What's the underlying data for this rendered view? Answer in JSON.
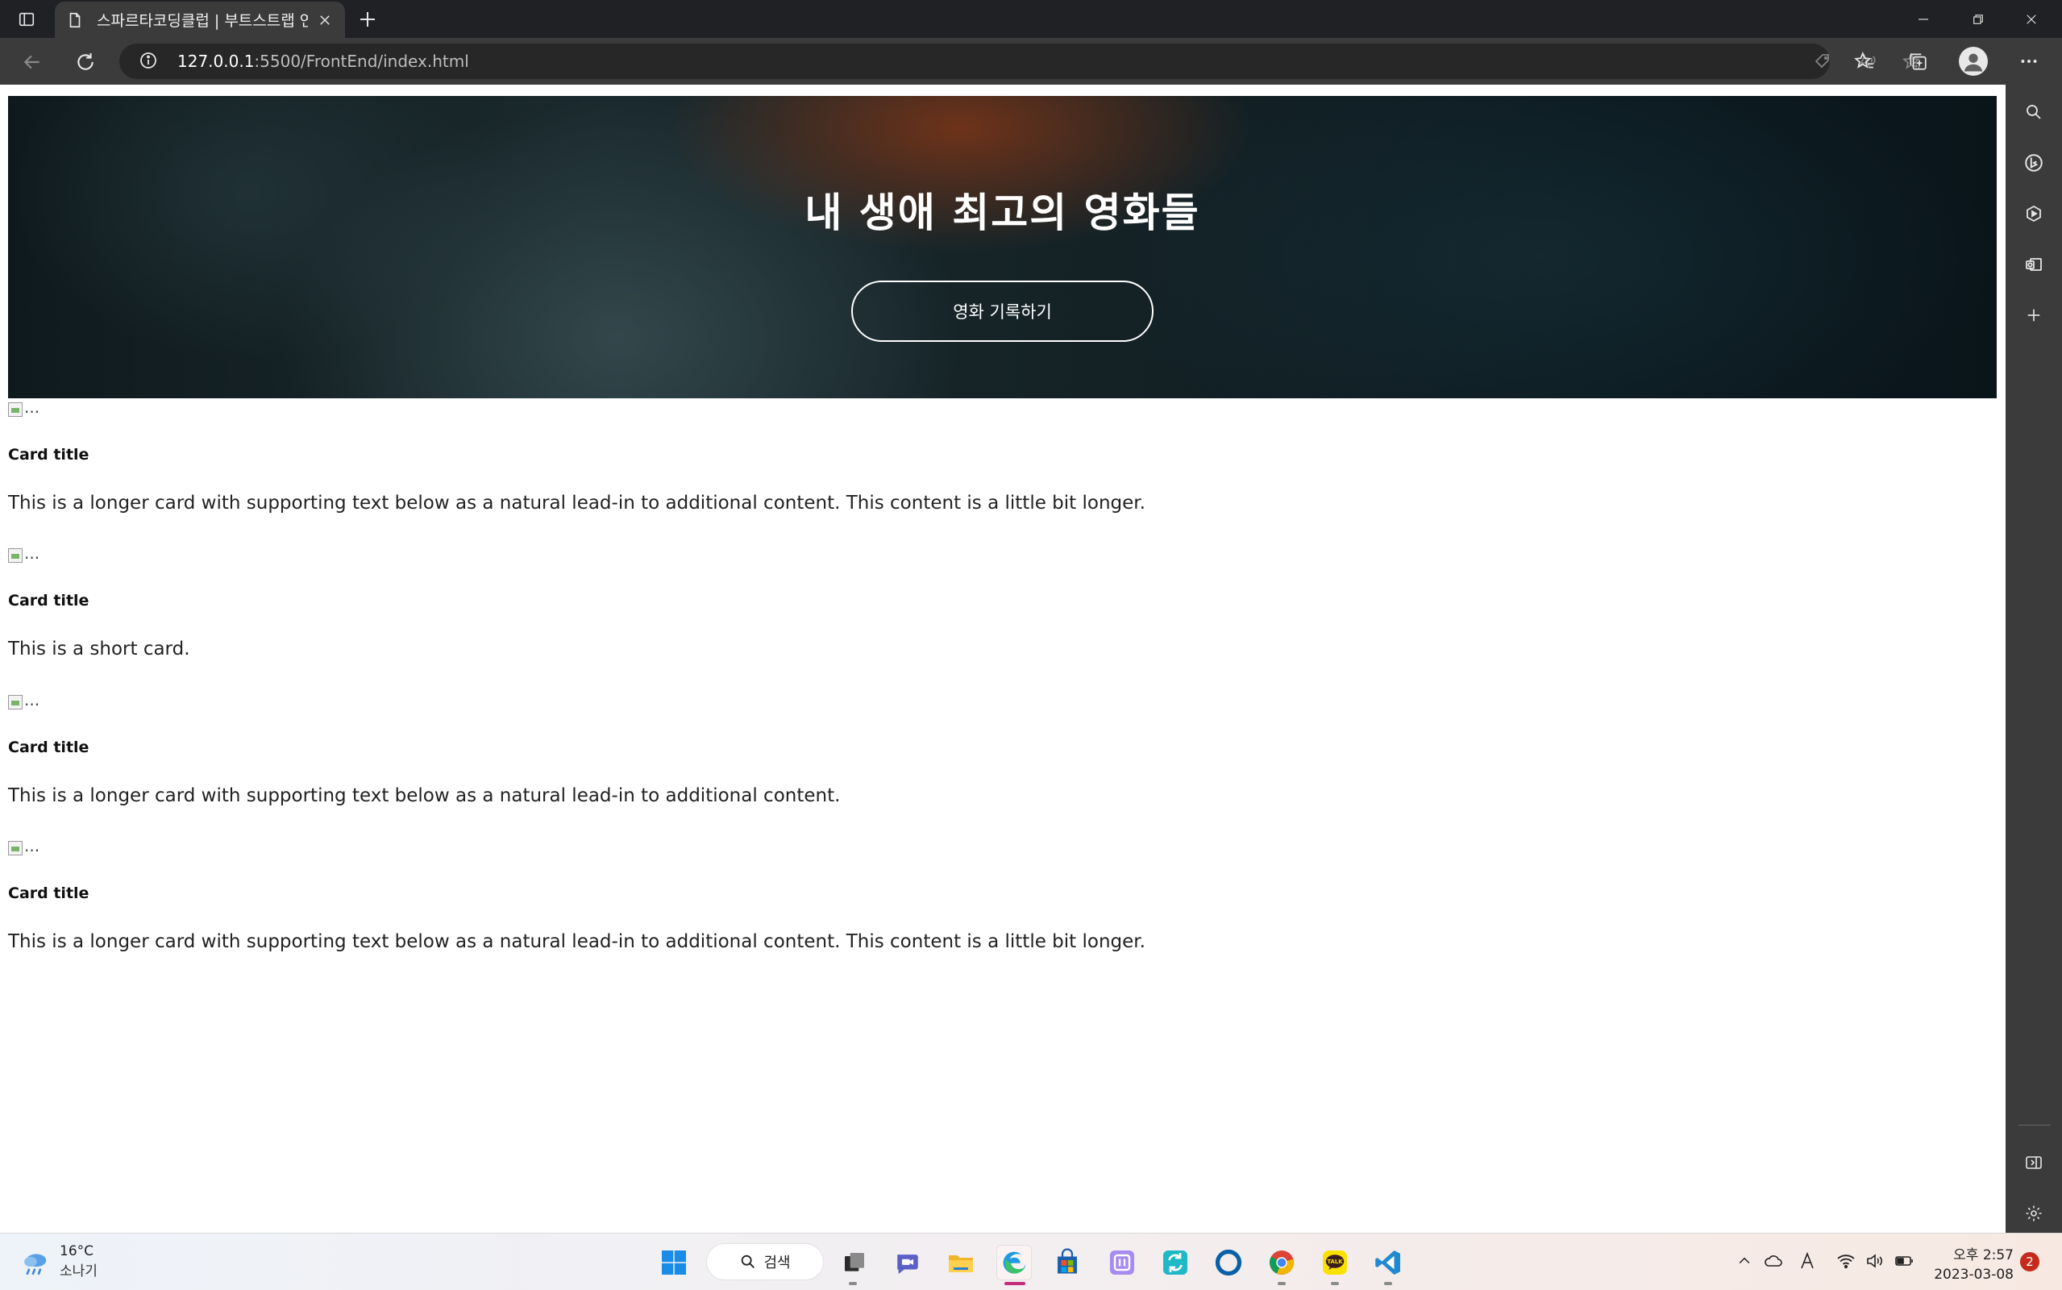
{
  "browser": {
    "tab_title": "스파르타코딩클럽 | 부트스트랩 연습",
    "url_host": "127.0.0.1",
    "url_path": ":5500/FrontEnd/index.html"
  },
  "hero": {
    "title": "내 생애 최고의 영화들",
    "button_label": "영화 기록하기"
  },
  "cards": [
    {
      "img_alt": "...",
      "title": "Card title",
      "text": "This is a longer card with supporting text below as a natural lead-in to additional content. This content is a little bit longer."
    },
    {
      "img_alt": "...",
      "title": "Card title",
      "text": "This is a short card."
    },
    {
      "img_alt": "...",
      "title": "Card title",
      "text": "This is a longer card with supporting text below as a natural lead-in to additional content."
    },
    {
      "img_alt": "...",
      "title": "Card title",
      "text": "This is a longer card with supporting text below as a natural lead-in to additional content. This content is a little bit longer."
    }
  ],
  "taskbar": {
    "weather_temp": "16°C",
    "weather_condition": "소나기",
    "search_label": "검색",
    "time": "오후 2:57",
    "date": "2023-03-08",
    "notification_count": "2"
  },
  "colors": {
    "chrome_dark": "#202124",
    "chrome_mid": "#3b3b3b",
    "notification_red": "#c42b1c",
    "edge_blue": "#0c59a4"
  }
}
